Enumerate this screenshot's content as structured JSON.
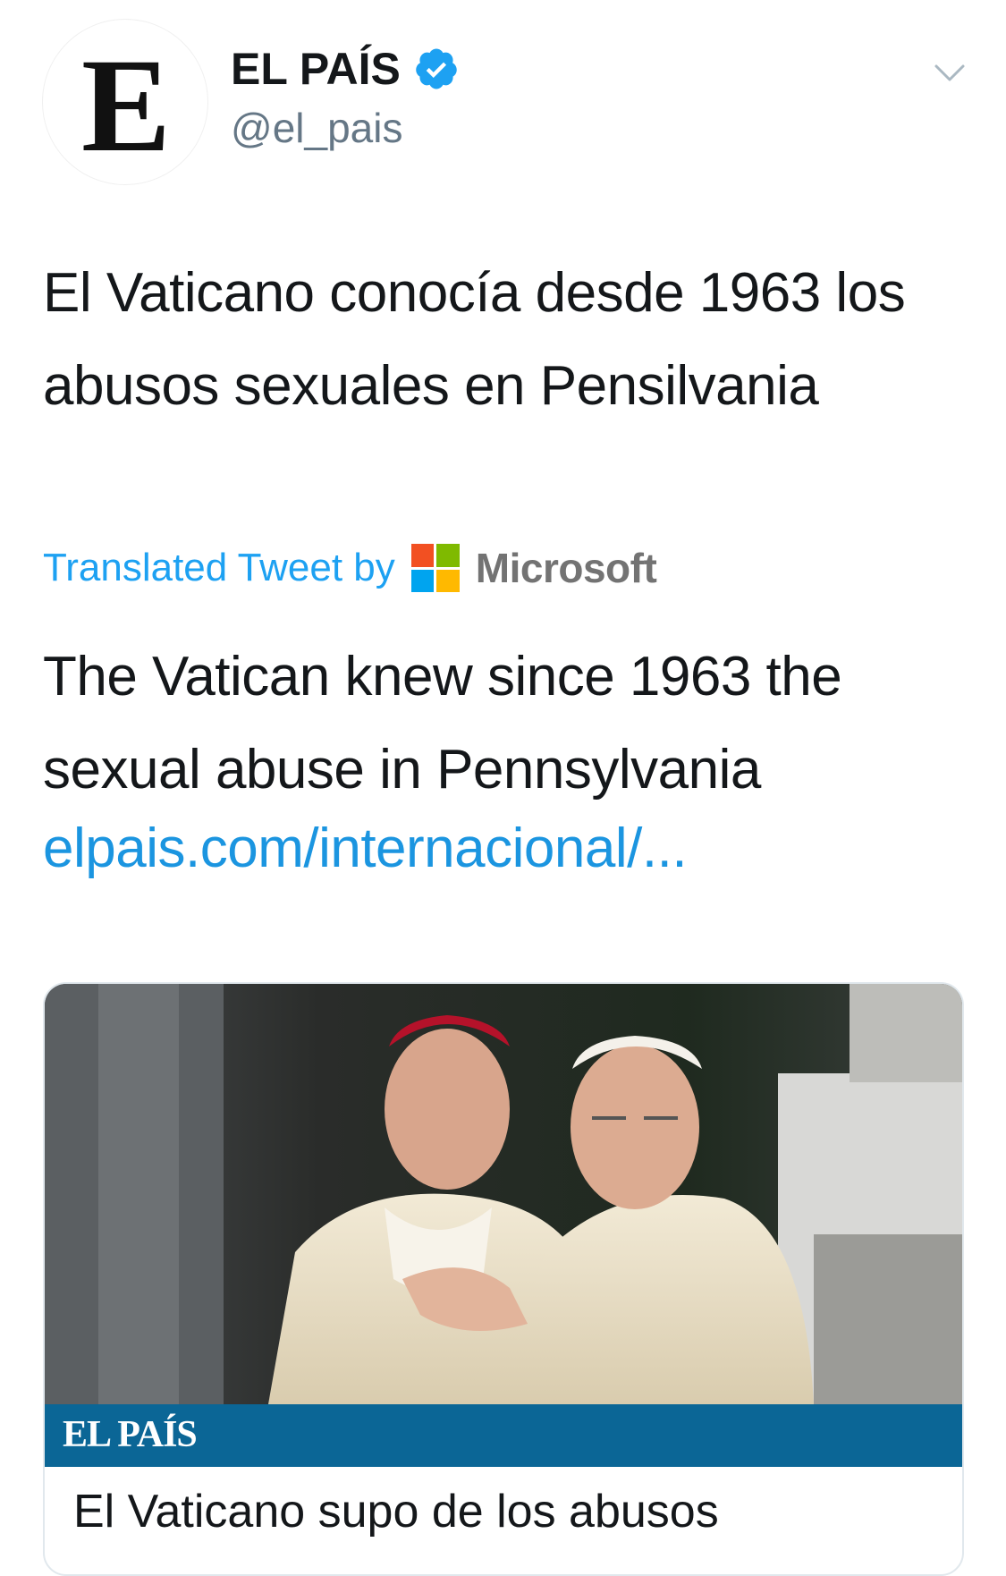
{
  "author": {
    "avatar_letter": "E",
    "display_name": "EL PAÍS",
    "handle": "@el_pais",
    "verified": true
  },
  "tweet": {
    "text": "El Vaticano conocía desde 1963 los abusos sexuales en Pensilvania",
    "translated_label": "Translated Tweet by",
    "translator_name": "Microsoft",
    "translation": "The Vatican knew since 1963 the sexual abuse in Pennsylvania",
    "link": "elpais.com/internacional/..."
  },
  "card": {
    "banner_text": "EL PAÍS",
    "title": "El Vaticano supo de los abusos"
  },
  "colors": {
    "accent": "#1da1f2",
    "link": "#1b95e0",
    "banner": "#0b6696",
    "text": "#14171a",
    "muted": "#657786"
  },
  "icons": {
    "verified": "verified-badge-icon",
    "menu": "chevron-down-icon",
    "translator_logo": "microsoft-logo-icon"
  }
}
